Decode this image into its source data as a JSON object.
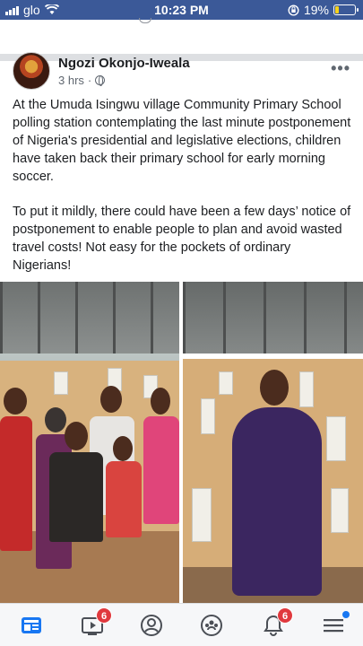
{
  "status_bar": {
    "carrier": "glo",
    "time": "10:23 PM",
    "battery_percent": "19%",
    "battery_level": 0.19,
    "battery_color": "#f7d21a"
  },
  "post": {
    "author": "Ngozi Okonjo-Iweala",
    "time_ago": "3 hrs",
    "more_label": "•••",
    "paragraphs": [
      "At the Umuda Isingwu village Community Primary School polling station contemplating the last minute postponement of Nigeria's presidential and legislative elections, children have taken back their primary school for early morning soccer.",
      "To put it mildly, there could have been a few days’ notice of postponement to enable people to plan and avoid wasted travel costs! Not easy for the pockets of ordinary Nigerians!"
    ]
  },
  "bottom_nav": {
    "items": [
      {
        "icon": "news-feed-icon",
        "active": true
      },
      {
        "icon": "watch-icon",
        "badge": "6"
      },
      {
        "icon": "profile-icon"
      },
      {
        "icon": "groups-icon"
      },
      {
        "icon": "notifications-icon",
        "badge": "6"
      },
      {
        "icon": "menu-icon",
        "dot": true
      }
    ]
  },
  "colors": {
    "brand": "#3b5998",
    "badge": "#e0393e",
    "nav_icon": "#4b4f56",
    "nav_active": "#1877f2"
  }
}
